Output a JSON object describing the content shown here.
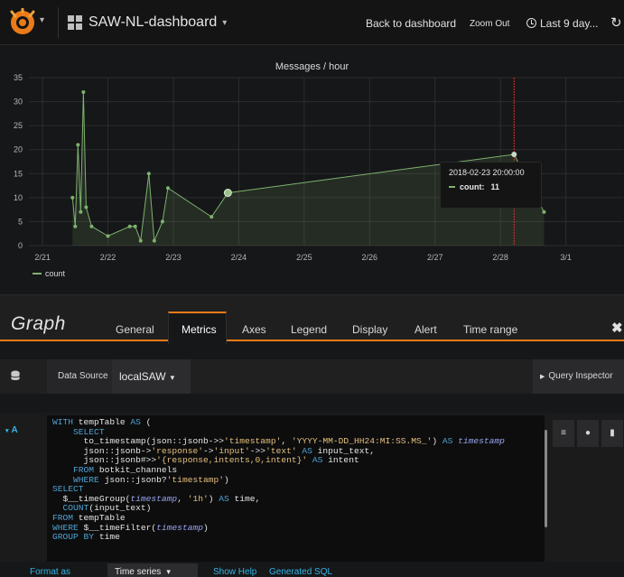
{
  "topbar": {
    "dashboard_title": "SAW-NL-dashboard",
    "back_label": "Back to dashboard",
    "zoom_label": "Zoom Out",
    "time_range_label": "Last 9 day...",
    "logo_color": "#eb7b18"
  },
  "panel": {
    "title": "Messages / hour",
    "legend_label": "count",
    "tooltip": {
      "time": "2018-02-23 20:00:00",
      "series": "count:",
      "value": "11"
    }
  },
  "chart_data": {
    "type": "area",
    "title": "Messages / hour",
    "x_ticks": [
      "2/21",
      "2/22",
      "2/23",
      "2/24",
      "2/25",
      "2/26",
      "2/27",
      "2/28",
      "3/1"
    ],
    "y_ticks": [
      "0",
      "5",
      "10",
      "15",
      "20",
      "25",
      "30",
      "35"
    ],
    "ylim": [
      0,
      35
    ],
    "xlim": [
      "2018-02-20T19:00",
      "2018-03-01T21:00"
    ],
    "grid": true,
    "legend_position": "bottom-left",
    "series": [
      {
        "name": "count",
        "color": "#7eb26d",
        "points": [
          [
            "2018-02-21T11:00",
            10
          ],
          [
            "2018-02-21T12:00",
            4
          ],
          [
            "2018-02-21T13:00",
            21
          ],
          [
            "2018-02-21T14:00",
            7
          ],
          [
            "2018-02-21T15:00",
            32
          ],
          [
            "2018-02-21T16:00",
            8
          ],
          [
            "2018-02-21T18:00",
            4
          ],
          [
            "2018-02-22T00:00",
            2
          ],
          [
            "2018-02-22T08:00",
            4
          ],
          [
            "2018-02-22T10:00",
            4
          ],
          [
            "2018-02-22T12:00",
            1
          ],
          [
            "2018-02-22T15:00",
            15
          ],
          [
            "2018-02-22T17:00",
            1
          ],
          [
            "2018-02-22T20:00",
            5
          ],
          [
            "2018-02-22T22:00",
            12
          ],
          [
            "2018-02-23T14:00",
            6
          ],
          [
            "2018-02-23T20:00",
            11
          ],
          [
            "2018-02-28T05:00",
            19
          ],
          [
            "2018-02-28T16:00",
            7
          ]
        ]
      }
    ],
    "highlight_x": "2018-02-28T05:00",
    "hover_x": "2018-02-23T20:00"
  },
  "editor": {
    "title": "Graph",
    "tabs": [
      "General",
      "Metrics",
      "Axes",
      "Legend",
      "Display",
      "Alert",
      "Time range"
    ],
    "active_tab": "Metrics",
    "datasource_label": "Data Source",
    "datasource_value": "localSAW",
    "query_inspector_label": "Query Inspector",
    "query_letter": "A",
    "bottom_tabs": {
      "format_as": "Format as",
      "format_value": "Time series",
      "show_help": "Show Help",
      "generated_sql": "Generated SQL"
    }
  },
  "accent_colors": {
    "orange": "#eb7b18",
    "blue": "#33b5e5",
    "series_green": "#7eb26d",
    "threshold_red": "#e02f2f"
  }
}
